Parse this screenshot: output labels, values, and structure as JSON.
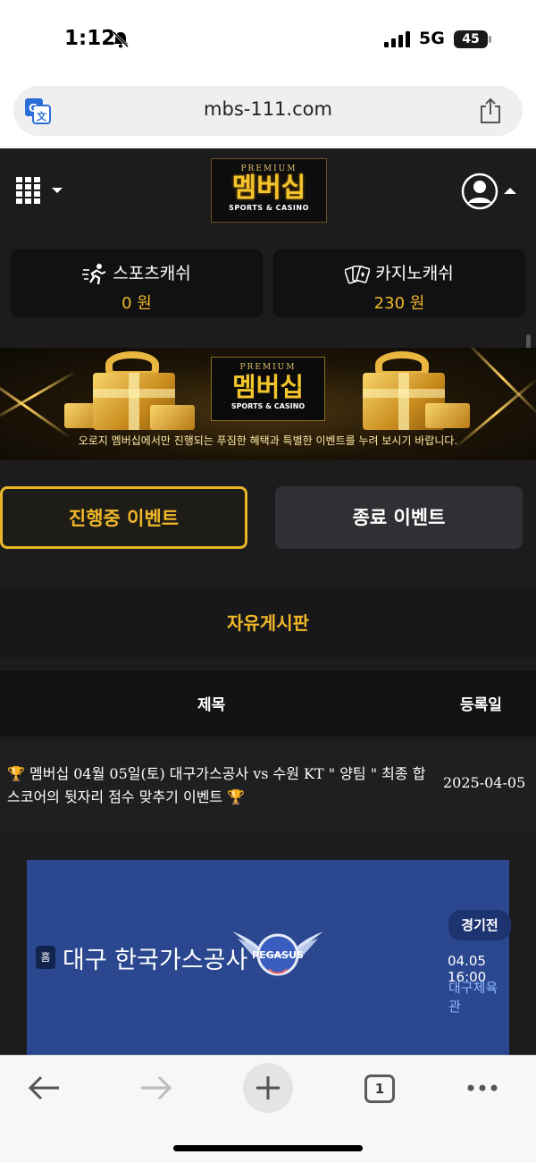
{
  "status_bar": {
    "time": "1:12",
    "network": "5G",
    "battery": "45"
  },
  "browser": {
    "url": "mbs-111.com",
    "tab_count": "1"
  },
  "site": {
    "logo": {
      "premium": "PREMIUM",
      "brand": "멤버십",
      "sub": "SPORTS & CASINO"
    },
    "wallets": [
      {
        "label": "스포츠캐쉬",
        "amount": "0 원",
        "icon": "running-person-icon"
      },
      {
        "label": "카지노캐쉬",
        "amount": "230 원",
        "icon": "playing-cards-icon"
      }
    ],
    "banner": {
      "tagline": "오로지 멤버십에서만 진행되는 푸짐한 혜택과 특별한 이벤트를 누려 보시기 바랍니다."
    },
    "tabs": {
      "active": "진행중 이벤트",
      "ended": "종료 이벤트"
    },
    "board": {
      "title": "자유게시판",
      "columns": {
        "subject": "제목",
        "date": "등록일"
      },
      "rows": [
        {
          "subject": "🏆 멤버십 04월 05일(토) 대구가스공사 vs 수원 KT \" 양팀 \" 최종 합 스코어의 뒷자리 점수 맞추기 이벤트 🏆",
          "date": "2025-04-05"
        }
      ]
    },
    "match": {
      "home_badge": "홈",
      "team": "대구 한국가스공사",
      "emblem": "PEGASUS",
      "stage": "경기전",
      "when": "04.05 16:00",
      "venue": "대구체육관"
    }
  },
  "colors": {
    "accent": "#f0b828",
    "background": "#1c1c1f",
    "match_card": "#2a478f"
  }
}
